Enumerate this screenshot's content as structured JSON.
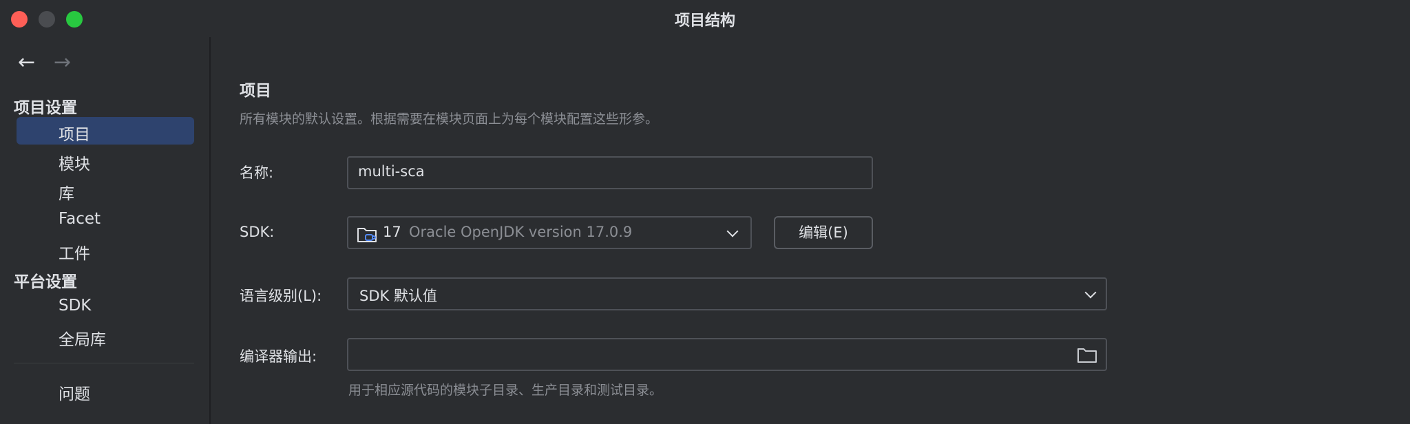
{
  "window": {
    "title": "项目结构"
  },
  "sidebar": {
    "project_settings_header": "项目设置",
    "project_items": [
      "项目",
      "模块",
      "库",
      "Facet",
      "工件"
    ],
    "platform_settings_header": "平台设置",
    "platform_items": [
      "SDK",
      "全局库"
    ],
    "problems_item": "问题",
    "selected_item": "项目"
  },
  "main": {
    "heading": "项目",
    "description": "所有模块的默认设置。根据需要在模块页面上为每个模块配置这些形参。",
    "name_label": "名称:",
    "name_value": "multi-sca",
    "sdk_label": "SDK:",
    "sdk_version": "17",
    "sdk_name": "Oracle OpenJDK version 17.0.9",
    "sdk_edit_button": "编辑(E)",
    "language_level_label": "语言级别(L):",
    "language_level_value": "SDK 默认值",
    "compiler_output_label": "编译器输出:",
    "compiler_output_value": "",
    "compiler_output_hint": "用于相应源代码的模块子目录、生产目录和测试目录。"
  },
  "colors": {
    "background": "#2b2d30",
    "selection": "#2e436e",
    "accent_blue": "#548af7",
    "muted_text": "#8b8e94"
  }
}
